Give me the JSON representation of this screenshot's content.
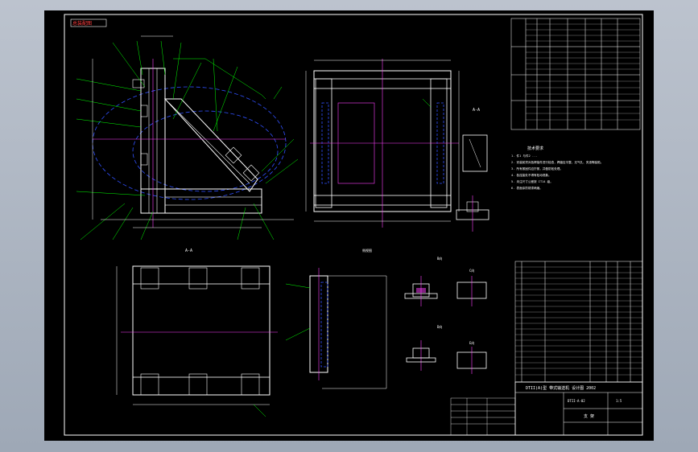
{
  "drawing": {
    "general_arrangement_label": "总装配图",
    "view_label_main": "A-A",
    "view_label_right": "侧视图",
    "view_label_b": "B向",
    "view_label_c": "C向",
    "view_label_d": "D向",
    "view_label_e": "E向",
    "scale": "1:5",
    "notes_title": "技术要求",
    "notes": [
      "1. 件1 与件2 ...",
      "2. 安装前须对各焊接件进行检查，焊缝应平整，无气孔、夹渣等缺陷。",
      "3. 所有紧固件应拧紧，并做防松处理。",
      "4. 各连接处不得有松动现象。",
      "5. 未注尺寸公差按 IT14 级。",
      "6. 表面涂防锈漆两遍。"
    ],
    "title_block": {
      "project": "DTII(A)型 带式输送机 设计图 2002",
      "drawing_no": "DTII-A-02",
      "name": "支 架",
      "scale_value": "1:5"
    }
  }
}
